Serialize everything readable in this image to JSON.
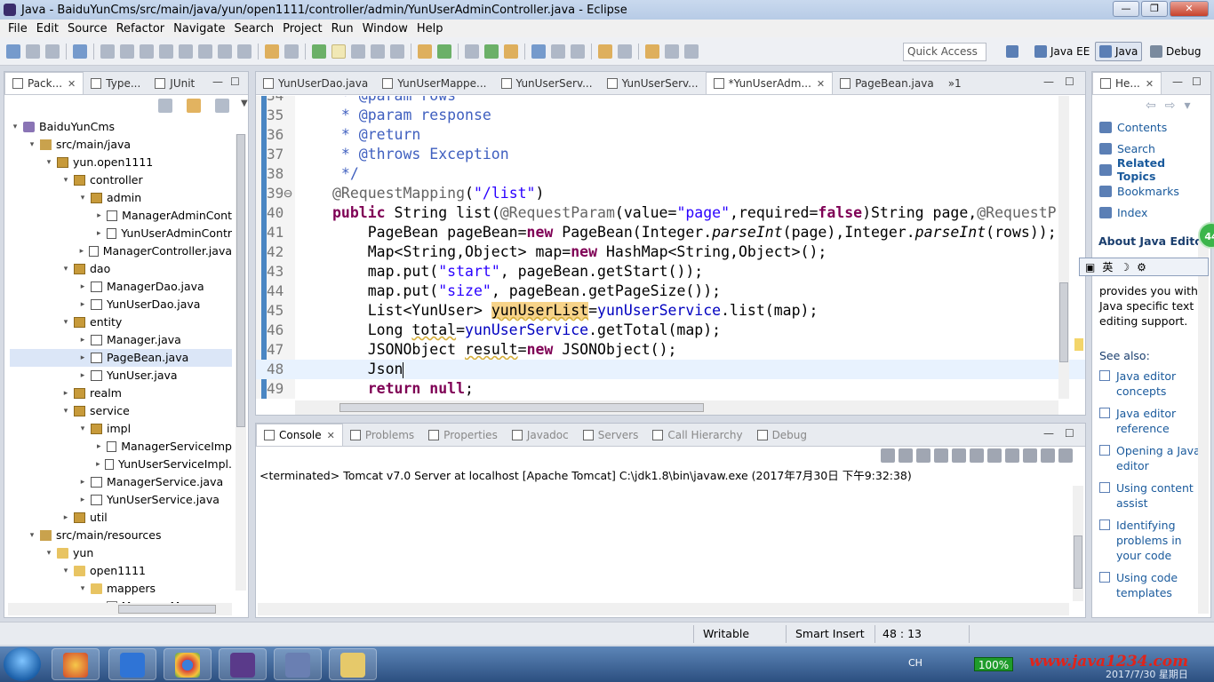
{
  "window": {
    "title": "Java - BaiduYunCms/src/main/java/yun/open1111/controller/admin/YunUserAdminController.java - Eclipse",
    "min": "—",
    "max": "❐",
    "close": "✕"
  },
  "menu": [
    "File",
    "Edit",
    "Source",
    "Refactor",
    "Navigate",
    "Search",
    "Project",
    "Run",
    "Window",
    "Help"
  ],
  "quick_access": "Quick Access",
  "perspectives": [
    "Java EE",
    "Java",
    "Debug"
  ],
  "explorer": {
    "tabs": [
      "Pack...",
      "Type...",
      "JUnit"
    ],
    "tree": [
      {
        "label": "BaiduYunCms",
        "indent": 0,
        "icon": "proj",
        "tw": "▾"
      },
      {
        "label": "src/main/java",
        "indent": 1,
        "icon": "src",
        "tw": "▾"
      },
      {
        "label": "yun.open1111",
        "indent": 2,
        "icon": "pkg",
        "tw": "▾"
      },
      {
        "label": "controller",
        "indent": 3,
        "icon": "pkg",
        "tw": "▾"
      },
      {
        "label": "admin",
        "indent": 4,
        "icon": "pkg",
        "tw": "▾"
      },
      {
        "label": "ManagerAdminCont",
        "indent": 5,
        "icon": "java",
        "tw": "▸"
      },
      {
        "label": "YunUserAdminContr",
        "indent": 5,
        "icon": "java",
        "tw": "▸"
      },
      {
        "label": "ManagerController.java",
        "indent": 4,
        "icon": "java",
        "tw": "▸"
      },
      {
        "label": "dao",
        "indent": 3,
        "icon": "pkg",
        "tw": "▾"
      },
      {
        "label": "ManagerDao.java",
        "indent": 4,
        "icon": "java",
        "tw": "▸"
      },
      {
        "label": "YunUserDao.java",
        "indent": 4,
        "icon": "java",
        "tw": "▸"
      },
      {
        "label": "entity",
        "indent": 3,
        "icon": "pkg",
        "tw": "▾"
      },
      {
        "label": "Manager.java",
        "indent": 4,
        "icon": "java",
        "tw": "▸"
      },
      {
        "label": "PageBean.java",
        "indent": 4,
        "icon": "java",
        "tw": "▸",
        "selected": true
      },
      {
        "label": "YunUser.java",
        "indent": 4,
        "icon": "java",
        "tw": "▸"
      },
      {
        "label": "realm",
        "indent": 3,
        "icon": "pkg",
        "tw": "▸"
      },
      {
        "label": "service",
        "indent": 3,
        "icon": "pkg",
        "tw": "▾"
      },
      {
        "label": "impl",
        "indent": 4,
        "icon": "pkg",
        "tw": "▾"
      },
      {
        "label": "ManagerServiceImp",
        "indent": 5,
        "icon": "java",
        "tw": "▸"
      },
      {
        "label": "YunUserServiceImpl.",
        "indent": 5,
        "icon": "java",
        "tw": "▸"
      },
      {
        "label": "ManagerService.java",
        "indent": 4,
        "icon": "java",
        "tw": "▸"
      },
      {
        "label": "YunUserService.java",
        "indent": 4,
        "icon": "java",
        "tw": "▸"
      },
      {
        "label": "util",
        "indent": 3,
        "icon": "pkg",
        "tw": "▸"
      },
      {
        "label": "src/main/resources",
        "indent": 1,
        "icon": "src",
        "tw": "▾"
      },
      {
        "label": "yun",
        "indent": 2,
        "icon": "fold",
        "tw": "▾"
      },
      {
        "label": "open1111",
        "indent": 3,
        "icon": "fold",
        "tw": "▾"
      },
      {
        "label": "mappers",
        "indent": 4,
        "icon": "fold",
        "tw": "▾"
      },
      {
        "label": "ManagerMapper.xm",
        "indent": 5,
        "icon": "xml",
        "tw": ""
      }
    ]
  },
  "editor": {
    "tabs": [
      "YunUserDao.java",
      "YunUserMappe...",
      "YunUserServ...",
      "YunUserServ...",
      "*YunUserAdm...",
      "PageBean.java"
    ],
    "active_tab": 4,
    "overflow": "»1",
    "lines": [
      {
        "n": "34",
        "html": "<span class='cm'> * @param rows</span>"
      },
      {
        "n": "35",
        "html": "<span class='cm'> * @param response</span>"
      },
      {
        "n": "36",
        "html": "<span class='cm'> * @return</span>"
      },
      {
        "n": "37",
        "html": "<span class='cm'> * @throws Exception</span>"
      },
      {
        "n": "38",
        "html": "<span class='cm'> */</span>"
      },
      {
        "n": "39⊖",
        "html": "<span class='ann'>@RequestMapping</span>(<span class='str'>\"/list\"</span>)"
      },
      {
        "n": "40",
        "html": "<span class='kw'>public</span> String list(<span class='ann'>@RequestParam</span>(value=<span class='str'>\"page\"</span>,required=<span class='kw'>false</span>)String page,<span class='ann'>@RequestP</span>"
      },
      {
        "n": "41",
        "html": "    PageBean pageBean=<span class='kw'>new</span> PageBean(Integer.<span class='it'>parseInt</span>(page),Integer.<span class='it'>parseInt</span>(rows));"
      },
      {
        "n": "42",
        "html": "    Map&lt;String,Object&gt; map=<span class='kw'>new</span> HashMap&lt;String,Object&gt;();"
      },
      {
        "n": "43",
        "html": "    map.put(<span class='str'>\"start\"</span>, pageBean.getStart());"
      },
      {
        "n": "44",
        "html": "    map.put(<span class='str'>\"size\"</span>, pageBean.getPageSize());"
      },
      {
        "n": "45",
        "html": "    List&lt;YunUser&gt; <span class='hl unused'>yunUserList</span>=<span class='fld'>yunUserService</span>.list(map);"
      },
      {
        "n": "46",
        "html": "    Long <span class='unused'>total</span>=<span class='fld'>yunUserService</span>.getTotal(map);"
      },
      {
        "n": "47",
        "html": "    JSONObject <span class='unused'>result</span>=<span class='kw'>new</span> JSONObject();"
      },
      {
        "n": "48",
        "html": "    Json<span class='caret'></span>",
        "current": true
      },
      {
        "n": "49",
        "html": "    <span class='kw'>return</span> <span class='kw'>null</span>;"
      }
    ]
  },
  "console": {
    "tabs": [
      "Console",
      "Problems",
      "Properties",
      "Javadoc",
      "Servers",
      "Call Hierarchy",
      "Debug"
    ],
    "terminated_line": "<terminated> Tomcat v7.0 Server at localhost [Apache Tomcat] C:\\jdk1.8\\bin\\javaw.exe (2017年7月30日 下午9:32:38)"
  },
  "help": {
    "tab": "He...",
    "links": [
      "Contents",
      "Search",
      "Related Topics",
      "Bookmarks",
      "Index"
    ],
    "about_title": "About Java Editor",
    "ime": [
      "英",
      "☽",
      "⚙"
    ],
    "text": "provides you with Java specific text editing support.",
    "see_also": "See also:",
    "see_also_items": [
      "Java editor concepts",
      "Java editor reference",
      "Opening a Java editor",
      "Using content assist",
      "Identifying problems in your code",
      "Using code templates"
    ]
  },
  "status": {
    "writable": "Writable",
    "insert": "Smart Insert",
    "position": "48 : 13"
  },
  "taskbar": {
    "battery": "100%",
    "watermark": "www.java1234.com",
    "clock": "2017/7/30 星期日",
    "lang": "CH"
  },
  "badge": "44"
}
